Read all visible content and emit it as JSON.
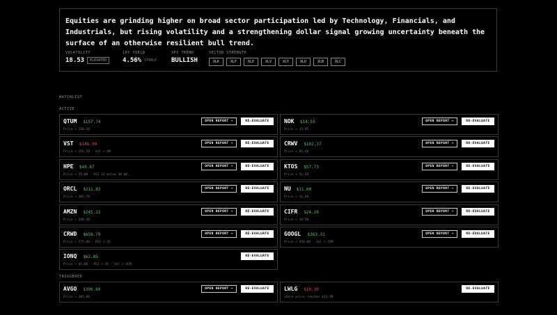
{
  "summary": {
    "headline": "Equities are grinding higher on broad sector participation led by Technology, Financials, and Industrials, but rising volatility and a strengthening dollar signal growing uncertainty beneath the surface of an otherwise resilient bull trend.",
    "volatility": {
      "label": "VOLATILITY",
      "value": "18.53",
      "chip": "ELEVATED"
    },
    "yield": {
      "label": "10Y YIELD",
      "value": "4.56%",
      "sub": "STABLE"
    },
    "trend": {
      "label": "SPX TREND",
      "value": "BULLISH"
    },
    "sector_strength": {
      "label": "SECTOR STRENGTH",
      "tickers": [
        "XLK",
        "XLF",
        "XLE",
        "XLV",
        "XLY",
        "XLU",
        "XLB",
        "XLC"
      ]
    }
  },
  "watchlist": {
    "title": "WATCHLIST",
    "active_label": "ACTIVE",
    "triggered_label": "TRIGGERED",
    "open_report_label": "OPEN REPORT →",
    "re_evaluate_label": "RE-EVALUATE",
    "active": [
      {
        "ticker": "QTUM",
        "price": "$157.74",
        "dir": "up",
        "condition": "Price < 150.50"
      },
      {
        "ticker": "NOK",
        "price": "$14.59",
        "dir": "up",
        "condition": "Price < 13.95"
      },
      {
        "ticker": "VST",
        "price": "$146.90",
        "dir": "down",
        "condition": "Price < 155.50 · Vol > 6M"
      },
      {
        "ticker": "CRWV",
        "price": "$102.37",
        "dir": "up",
        "condition": "Price < 95.50"
      },
      {
        "ticker": "HPE",
        "price": "$49.87",
        "dir": "up",
        "condition": "Price < 35.00 · RSI 14 below 30.00,"
      },
      {
        "ticker": "KTOS",
        "price": "$57.73",
        "dir": "up",
        "condition": "Price < 51.50"
      },
      {
        "ticker": "ORCL",
        "price": "$211.82",
        "dir": "up",
        "condition": "Price < 205.70"
      },
      {
        "ticker": "NU",
        "price": "$11.60",
        "dir": "up",
        "condition": "Price < 11.60"
      },
      {
        "ticker": "AMZN",
        "price": "$245.22",
        "dir": "up",
        "condition": "Price < 240.20"
      },
      {
        "ticker": "CIFR",
        "price": "$24.29",
        "dir": "up",
        "condition": "Price < 18.50"
      },
      {
        "ticker": "CRWD",
        "price": "$658.79",
        "dir": "up",
        "condition": "Price < 575.00 · RSI < 45"
      },
      {
        "ticker": "GOOGL",
        "price": "$363.31",
        "dir": "up",
        "condition": "Price < 350.00 · Vol > 35M"
      },
      {
        "ticker": "IONQ",
        "price": "$62.85",
        "dir": "up",
        "condition": "Price < 45.88 · RSI < 45 · Vol > 45M"
      }
    ],
    "triggered": [
      {
        "ticker": "AVGO",
        "price": "$396.60",
        "dir": "up",
        "condition": "Price < 385.80"
      },
      {
        "ticker": "LWLG",
        "price": "$10.30",
        "dir": "down",
        "condition": "share price reaches $11.10"
      }
    ]
  }
}
